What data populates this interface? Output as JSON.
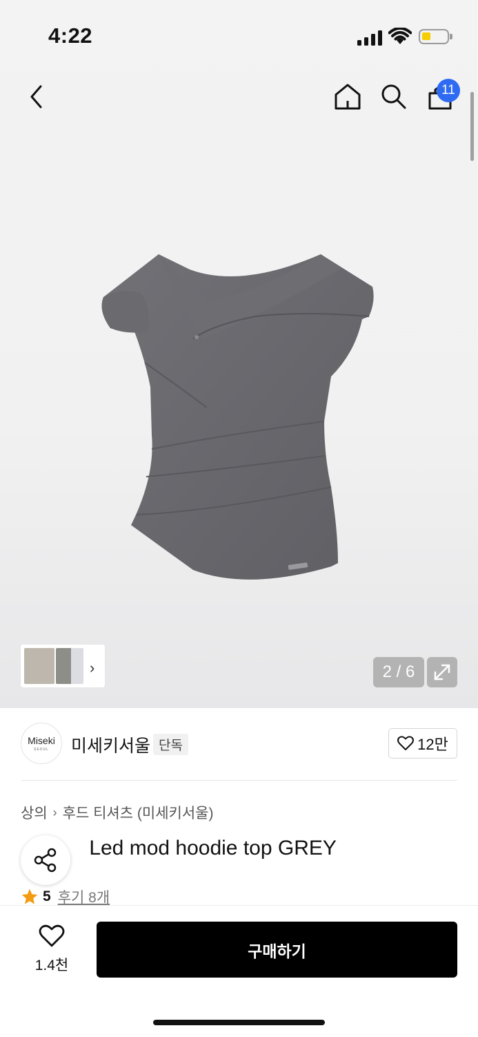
{
  "status_bar": {
    "time": "4:22"
  },
  "nav": {
    "cart_count": "11"
  },
  "gallery": {
    "counter": "2 / 6",
    "current": 2,
    "total": 6
  },
  "brand": {
    "logo_text": "Miseki",
    "logo_subtext": "SEOUL",
    "name": "미세키서울",
    "tag": "단독",
    "likes": "12만"
  },
  "breadcrumb": {
    "category": "상의",
    "subcategory": "후드 티셔츠 (미세키서울)"
  },
  "product": {
    "title": "Layered mod hoodie top GREY",
    "title_visible": "ed mod hoodie top GREY",
    "rating": "5",
    "reviews": "후기 8개"
  },
  "bottom_bar": {
    "wish_count": "1.4천",
    "buy_label": "구매하기"
  },
  "colors": {
    "accent": "#2e6bf2",
    "star": "#f39c12",
    "buy_bg": "#000000",
    "battery": "#f6cd00"
  },
  "icons": [
    "back-icon",
    "home-icon",
    "search-icon",
    "bag-icon",
    "share-icon",
    "heart-icon",
    "star-icon",
    "expand-icon",
    "chevron-right-icon"
  ]
}
